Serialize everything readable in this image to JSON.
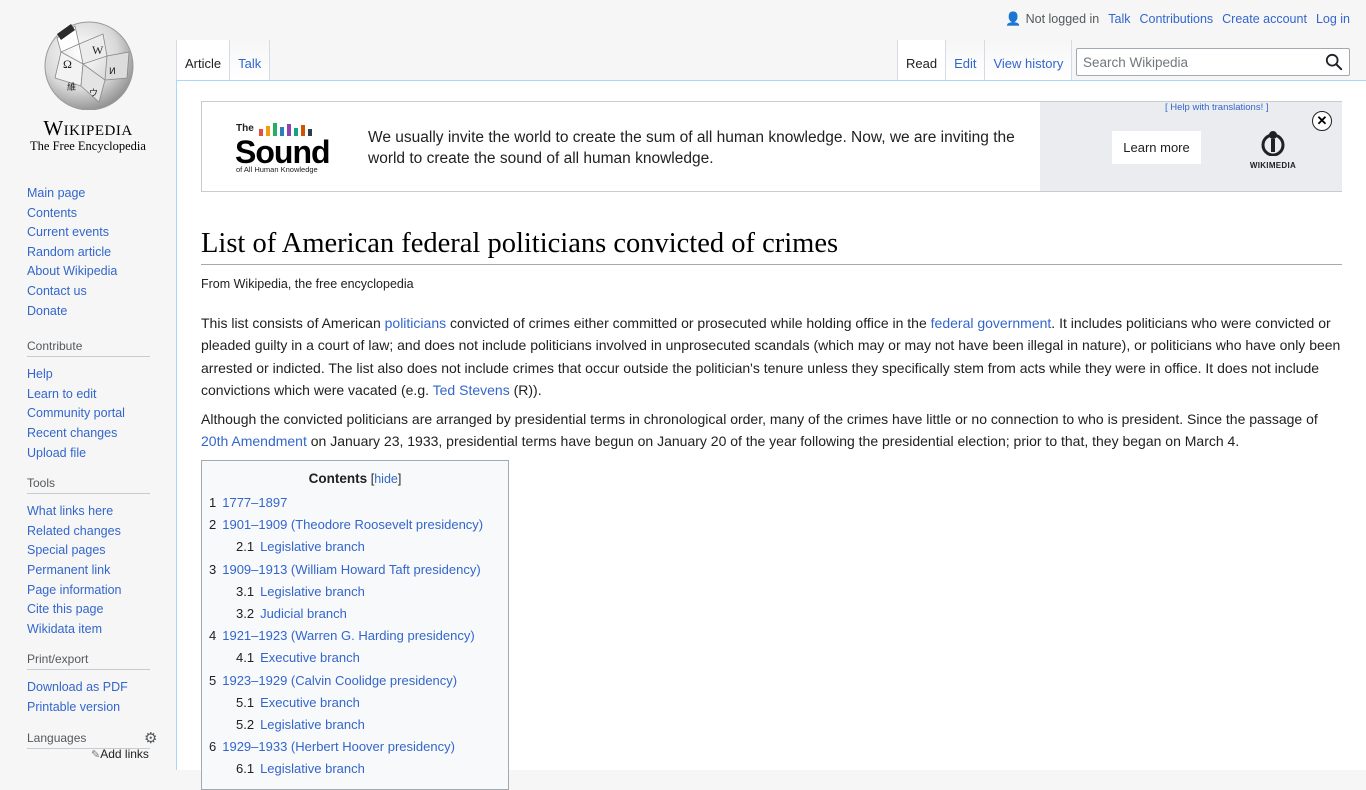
{
  "site": {
    "wordmark": "Wikipedia",
    "tagline": "The Free Encyclopedia"
  },
  "personal": {
    "not_logged_in": "Not logged in",
    "talk": "Talk",
    "contributions": "Contributions",
    "create_account": "Create account",
    "login": "Log in"
  },
  "tabs": {
    "article": "Article",
    "talk": "Talk",
    "read": "Read",
    "edit": "Edit",
    "history": "View history"
  },
  "search": {
    "placeholder": "Search Wikipedia"
  },
  "sidebar": {
    "navigation": [
      "Main page",
      "Contents",
      "Current events",
      "Random article",
      "About Wikipedia",
      "Contact us",
      "Donate"
    ],
    "contribute": {
      "heading": "Contribute",
      "items": [
        "Help",
        "Learn to edit",
        "Community portal",
        "Recent changes",
        "Upload file"
      ]
    },
    "tools": {
      "heading": "Tools",
      "items": [
        "What links here",
        "Related changes",
        "Special pages",
        "Permanent link",
        "Page information",
        "Cite this page",
        "Wikidata item"
      ]
    },
    "print": {
      "heading": "Print/export",
      "items": [
        "Download as PDF",
        "Printable version"
      ]
    },
    "languages": {
      "heading": "Languages",
      "add_links": "Add links"
    }
  },
  "banner": {
    "logo_the": "The",
    "logo_word": "Sound",
    "logo_sub": "of All Human Knowledge",
    "text": "We usually invite the world to create the sum of all human knowledge. Now, we are inviting the world to create the sound of all human knowledge.",
    "help_translations": "[ Help with translations! ]",
    "learn_more": "Learn more",
    "close": "✕",
    "wikimedia": "WIKIMEDIA",
    "colors": {
      "bg_right": "#eaecf0",
      "bars": [
        "#e74c3c",
        "#f39c12",
        "#27ae60",
        "#2980b9",
        "#8e44ad",
        "#16a085",
        "#d35400",
        "#2c3e50"
      ]
    }
  },
  "article": {
    "title": "List of American federal politicians convicted of crimes",
    "from": "From Wikipedia, the free encyclopedia",
    "p1": {
      "t1": "This list consists of American ",
      "l1": "politicians",
      "t2": " convicted of crimes either committed or prosecuted while holding office in the ",
      "l2": "federal government",
      "t3": ". It includes politicians who were convicted or pleaded guilty in a court of law; and does not include politicians involved in unprosecuted scandals (which may or may not have been illegal in nature), or politicians who have only been arrested or indicted. The list also does not include crimes that occur outside the politician's tenure unless they specifically stem from acts while they were in office. It does not include convictions which were vacated (e.g. ",
      "l3": "Ted Stevens",
      "t4": " (R))."
    },
    "p2": {
      "t1": "Although the convicted politicians are arranged by presidential terms in chronological order, many of the crimes have little or no connection to who is president. Since the passage of ",
      "l1": "20th Amendment",
      "t2": " on January 23, 1933, presidential terms have begun on January 20 of the year following the presidential election; prior to that, they began on March 4."
    }
  },
  "toc": {
    "title": "Contents",
    "hide": "hide",
    "items": [
      {
        "num": "1",
        "label": "1777–1897",
        "level": 1
      },
      {
        "num": "2",
        "label": "1901–1909 (Theodore Roosevelt presidency)",
        "level": 1
      },
      {
        "num": "2.1",
        "label": "Legislative branch",
        "level": 2
      },
      {
        "num": "3",
        "label": "1909–1913 (William Howard Taft presidency)",
        "level": 1
      },
      {
        "num": "3.1",
        "label": "Legislative branch",
        "level": 2
      },
      {
        "num": "3.2",
        "label": "Judicial branch",
        "level": 2
      },
      {
        "num": "4",
        "label": "1921–1923 (Warren G. Harding presidency)",
        "level": 1
      },
      {
        "num": "4.1",
        "label": "Executive branch",
        "level": 2
      },
      {
        "num": "5",
        "label": "1923–1929 (Calvin Coolidge presidency)",
        "level": 1
      },
      {
        "num": "5.1",
        "label": "Executive branch",
        "level": 2
      },
      {
        "num": "5.2",
        "label": "Legislative branch",
        "level": 2
      },
      {
        "num": "6",
        "label": "1929–1933 (Herbert Hoover presidency)",
        "level": 1
      },
      {
        "num": "6.1",
        "label": "Legislative branch",
        "level": 2
      }
    ]
  }
}
